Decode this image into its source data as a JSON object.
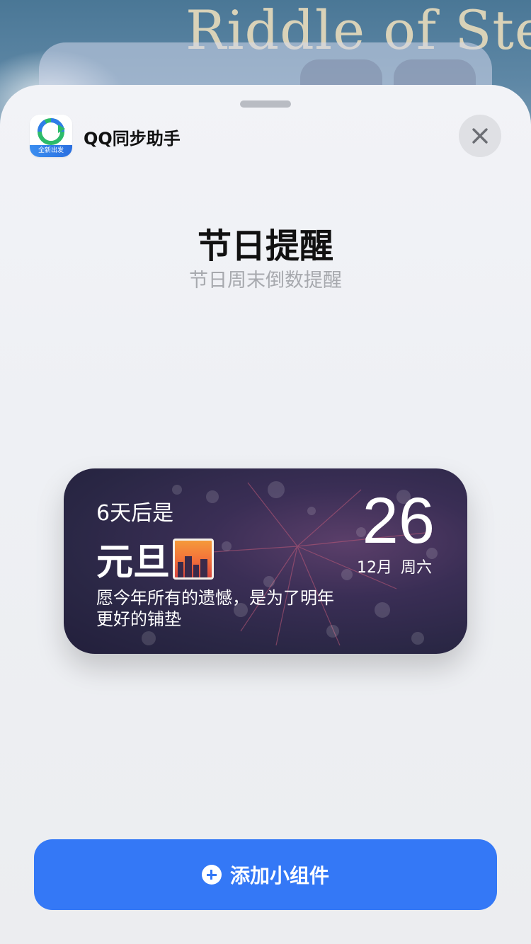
{
  "background": {
    "wallpaper_text": "Riddle of Stea"
  },
  "sheet": {
    "app": {
      "name": "QQ同步助手",
      "icon_badge": "全新出发"
    },
    "widget": {
      "title": "节日提醒",
      "subtitle": "节日周末倒数提醒"
    },
    "preview": {
      "countdown": "6天后是",
      "holiday": "元旦",
      "quote": "愿今年所有的遗憾，是为了明年更好的铺垫",
      "date_number": "26",
      "month": "12月",
      "weekday": "周六"
    },
    "add_button": {
      "label": "添加小组件"
    }
  },
  "colors": {
    "accent": "#3478f6",
    "sheet_bg": "#eef0f4",
    "widget_bg": "#2a2745"
  }
}
